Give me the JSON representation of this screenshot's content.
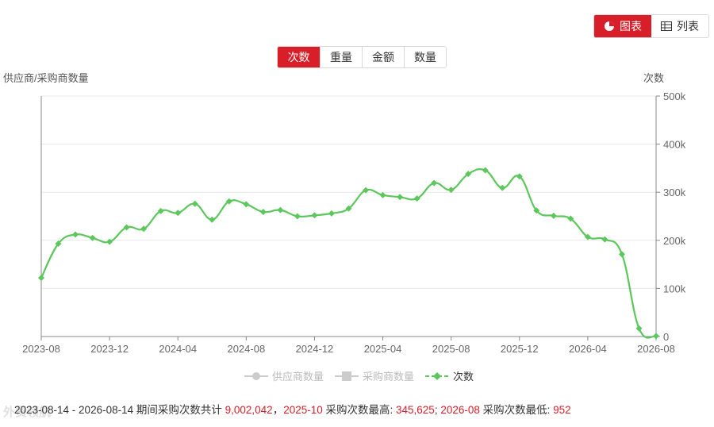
{
  "view_toggle": {
    "chart_label": "图表",
    "list_label": "列表"
  },
  "metric_tabs": [
    {
      "label": "次数",
      "active": true
    },
    {
      "label": "重量",
      "active": false
    },
    {
      "label": "金额",
      "active": false
    },
    {
      "label": "数量",
      "active": false
    }
  ],
  "left_axis_title": "供应商/采购商数量",
  "right_axis_title": "次数",
  "legend": [
    {
      "label": "供应商数量",
      "active": false
    },
    {
      "label": "采购商数量",
      "active": false
    },
    {
      "label": "次数",
      "active": true
    }
  ],
  "summary": {
    "date_range": "2023-08-14 - 2026-08-14",
    "text1": " 期间采购次数共计 ",
    "total": "9,002,042",
    "sep1": "，",
    "max_month": "2025-10",
    "text2": " 采购次数最高: ",
    "max_value": "345,625",
    "sep2": "; ",
    "min_month": "2026-08",
    "text3": " 采购次数最低: ",
    "min_value": "952"
  },
  "watermark": "外贸领航",
  "colors": {
    "accent": "#d81e28",
    "series": "#5cc75c"
  },
  "chart_data": {
    "type": "line",
    "x": [
      "2023-08",
      "2023-09",
      "2023-10",
      "2023-11",
      "2023-12",
      "2024-01",
      "2024-02",
      "2024-03",
      "2024-04",
      "2024-05",
      "2024-06",
      "2024-07",
      "2024-08",
      "2024-09",
      "2024-10",
      "2024-11",
      "2024-12",
      "2025-01",
      "2025-02",
      "2025-03",
      "2025-04",
      "2025-05",
      "2025-06",
      "2025-07",
      "2025-08",
      "2025-09",
      "2025-10",
      "2025-11",
      "2025-12",
      "2026-01",
      "2026-02",
      "2026-03",
      "2026-04",
      "2026-05",
      "2026-06",
      "2026-07",
      "2026-08"
    ],
    "x_tick_labels": [
      "2023-08",
      "2023-12",
      "2024-04",
      "2024-08",
      "2024-12",
      "2025-04",
      "2025-08",
      "2025-12",
      "2026-04",
      "2026-08"
    ],
    "series": [
      {
        "name": "次数",
        "values": [
          122000,
          193000,
          212000,
          205000,
          197000,
          227000,
          224000,
          261000,
          257000,
          276000,
          243000,
          281000,
          275000,
          259000,
          263000,
          250000,
          252000,
          256000,
          266000,
          304000,
          294000,
          290000,
          287000,
          319000,
          305000,
          338000,
          345625,
          309000,
          333000,
          262000,
          251000,
          245000,
          207000,
          202000,
          171000,
          17000,
          952
        ]
      }
    ],
    "y_right_label": "次数",
    "y_left_label": "供应商/采购商数量",
    "ylim": [
      0,
      500000
    ],
    "y_ticks": [
      0,
      100000,
      200000,
      300000,
      400000,
      500000
    ],
    "y_tick_labels": [
      "0",
      "100k",
      "200k",
      "300k",
      "400k",
      "500k"
    ],
    "grid": true
  }
}
